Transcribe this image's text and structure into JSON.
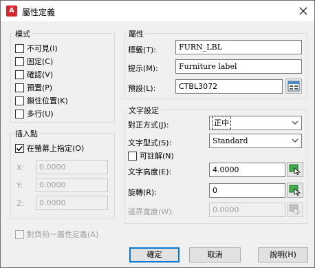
{
  "window": {
    "app_icon": "A",
    "title": "屬性定義",
    "close_icon": "close-icon"
  },
  "mode": {
    "title": "模式",
    "items": [
      {
        "label": "不可見(I)",
        "checked": false
      },
      {
        "label": "固定(C)",
        "checked": false
      },
      {
        "label": "確認(V)",
        "checked": false
      },
      {
        "label": "預置(P)",
        "checked": false
      },
      {
        "label": "鎖住位置(K)",
        "checked": false
      },
      {
        "label": "多行(U)",
        "checked": false
      }
    ]
  },
  "insertion": {
    "title": "插入點",
    "specify_on_screen": {
      "label": "在螢幕上指定(O)",
      "checked": true
    },
    "x": {
      "label": "X:",
      "value": "0.0000"
    },
    "y": {
      "label": "Y:",
      "value": "0.0000"
    },
    "z": {
      "label": "Z:",
      "value": "0.0000"
    }
  },
  "attribute": {
    "title": "屬性",
    "tag": {
      "label": "標籤(T):",
      "value": "FURN_LBL"
    },
    "prompt": {
      "label": "提示(M):",
      "value": "Furniture label"
    },
    "default": {
      "label": "預設(L):",
      "value": "CTBL3072"
    }
  },
  "text_settings": {
    "title": "文字設定",
    "justification": {
      "label": "對正方式(J):",
      "value": "正中"
    },
    "text_style": {
      "label": "文字型式(S):",
      "value": "Standard"
    },
    "annotative": {
      "label": "可註解(N)",
      "checked": false
    },
    "text_height": {
      "label": "文字高度(E):",
      "value": "4.0000"
    },
    "rotation": {
      "label": "旋轉(R):",
      "value": "0"
    },
    "boundary_width": {
      "label": "邊界寬度(W):",
      "value": "0.0000"
    }
  },
  "align_below": {
    "label": "對齊前一屬性定義(A)",
    "checked": false
  },
  "buttons": {
    "ok": "確定",
    "cancel": "取消",
    "help": "說明(H)"
  }
}
